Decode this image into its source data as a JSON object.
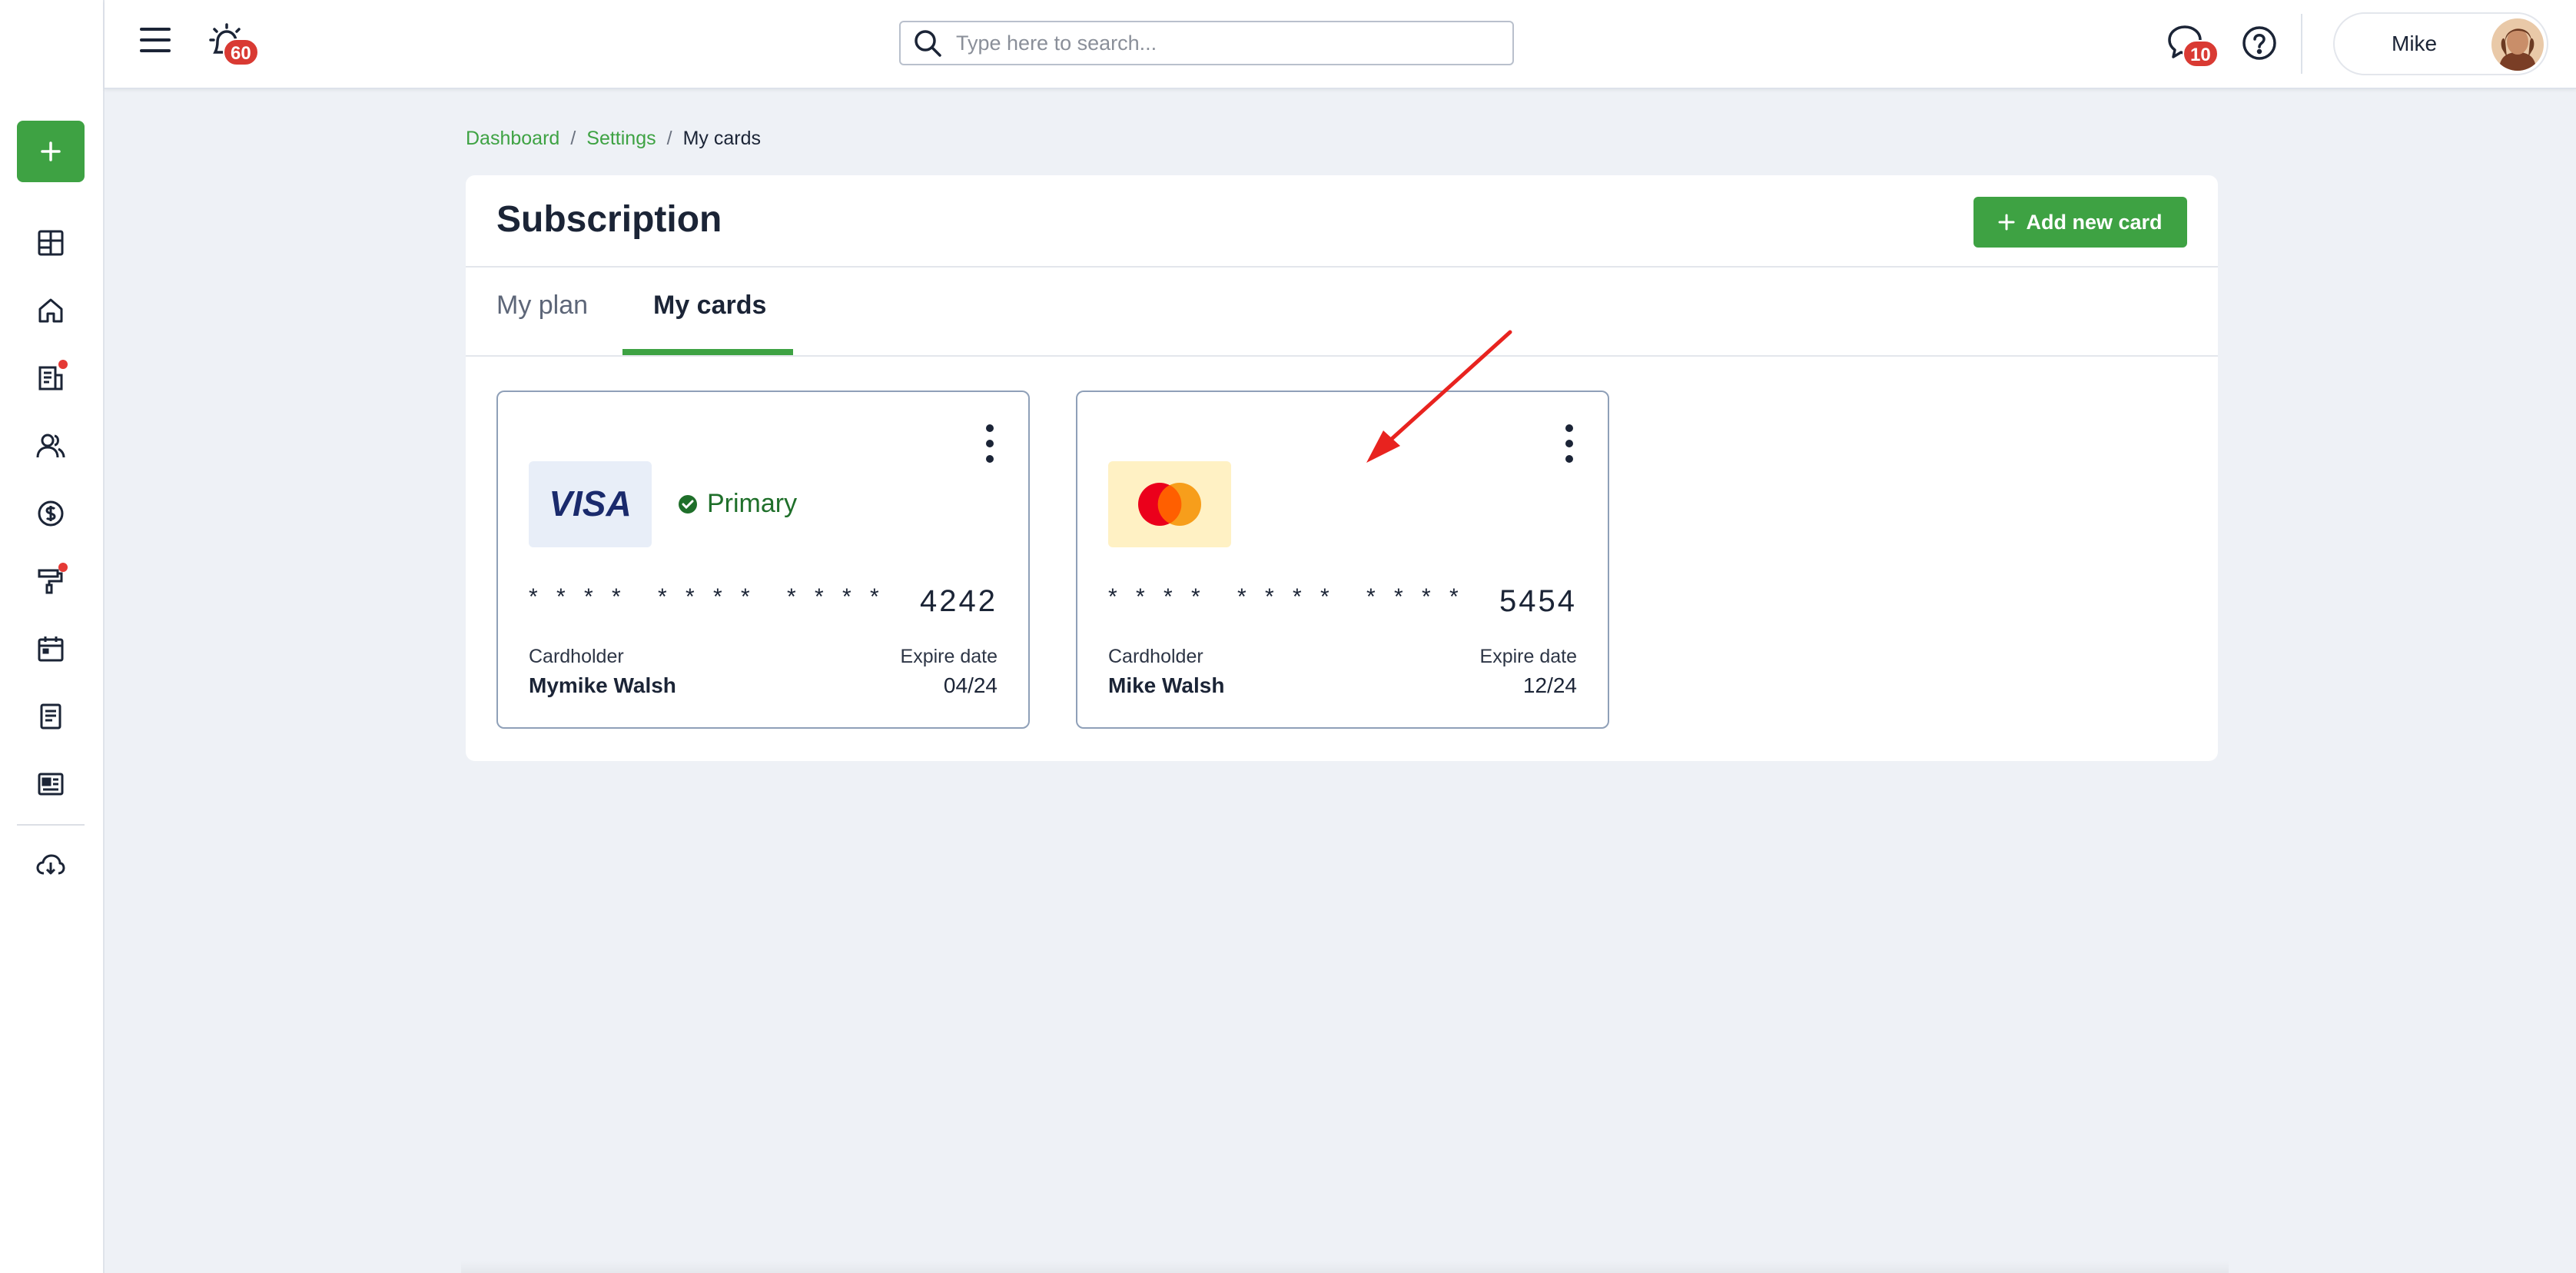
{
  "header": {
    "notifications_count": "60",
    "messages_count": "10",
    "search_placeholder": "Type here to search...",
    "user_name": "Mike"
  },
  "sidebar": {
    "items": [
      {
        "name": "sidebar-add-button",
        "icon": "plus-icon"
      },
      {
        "name": "sidebar-item-dashboard",
        "icon": "dashboard-grid-icon"
      },
      {
        "name": "sidebar-item-home",
        "icon": "home-icon"
      },
      {
        "name": "sidebar-item-reports",
        "icon": "report-icon",
        "dot": true
      },
      {
        "name": "sidebar-item-people",
        "icon": "users-icon"
      },
      {
        "name": "sidebar-item-payments",
        "icon": "dollar-circle-icon"
      },
      {
        "name": "sidebar-item-tools",
        "icon": "paint-roller-icon",
        "dot": true
      },
      {
        "name": "sidebar-item-calendar",
        "icon": "calendar-icon"
      },
      {
        "name": "sidebar-item-documents",
        "icon": "document-icon"
      },
      {
        "name": "sidebar-item-news",
        "icon": "newspaper-icon"
      },
      {
        "name": "sidebar-item-download",
        "icon": "cloud-download-icon"
      }
    ]
  },
  "breadcrumb": {
    "items": [
      "Dashboard",
      "Settings",
      "My cards"
    ],
    "separator": "/"
  },
  "page": {
    "title": "Subscription",
    "add_card_label": "Add new card",
    "tabs": [
      {
        "label": "My plan",
        "active": false
      },
      {
        "label": "My cards",
        "active": true
      }
    ]
  },
  "cards": [
    {
      "brand": "VISA",
      "primary_label": "Primary",
      "masked": "* * * *",
      "last4": "4242",
      "cardholder_label": "Cardholder",
      "cardholder": "Mymike Walsh",
      "expire_label": "Expire date",
      "expire": "04/24"
    },
    {
      "brand": "mastercard",
      "masked": "* * * *",
      "last4": "5454",
      "cardholder_label": "Cardholder",
      "cardholder": "Mike Walsh",
      "expire_label": "Expire date",
      "expire": "12/24"
    }
  ],
  "colors": {
    "accent": "#3ea243",
    "badge": "#d93a33",
    "annotation_arrow": "#e8231f"
  }
}
